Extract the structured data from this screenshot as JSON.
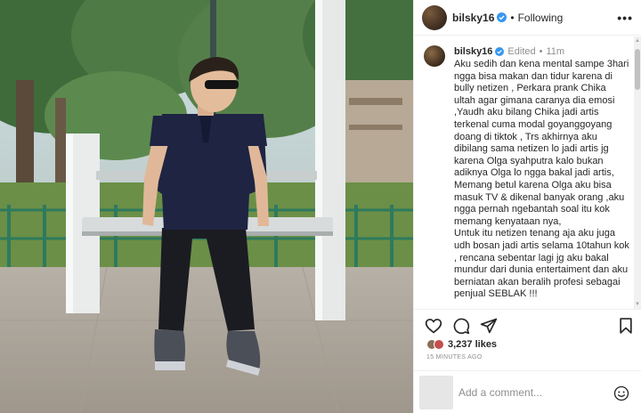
{
  "post": {
    "username": "bilsky16",
    "follow_status": "Following",
    "more_glyph": "•••"
  },
  "caption": {
    "username": "bilsky16",
    "edited": "Edited",
    "time": "11m",
    "paragraphs": [
      "Aku sedih dan kena mental sampe 3hari ngga bisa makan dan tidur karena di bully netizen , Perkara prank Chika ultah agar gimana caranya dia emosi ,Yaudh aku bilang Chika jadi artis terkenal cuma modal goyanggoyang doang di tiktok , Trs akhirnya aku dibilang sama netizen lo jadi artis jg karena Olga syahputra kalo bukan adiknya Olga lo ngga bakal jadi artis, Memang betul karena Olga aku bisa masuk TV & dikenal banyak orang ,aku ngga pernah ngebantah soal itu kok memang kenyataan nya,",
      "Untuk itu netizen tenang aja aku juga udh bosan jadi artis selama 10tahun kok , rencana sebentar lagi jg aku bakal mundur dari dunia entertaiment dan aku berniatan akan beralih profesi sebagai penjual SEBLAK !!!"
    ]
  },
  "stats": {
    "likes": "3,237 likes",
    "timestamp": "15 MINUTES AGO"
  },
  "comment_box": {
    "placeholder": "Add a comment..."
  },
  "icons": {
    "verified": "verified-badge-icon",
    "like": "heart-icon",
    "comment": "comment-bubble-icon",
    "share": "paper-plane-icon",
    "save": "bookmark-icon",
    "emoji": "smiley-icon",
    "more": "more-options-icon"
  },
  "colors": {
    "verified_blue": "#3897f0",
    "text": "#262626",
    "muted": "#8e8e8e",
    "border": "#efefef"
  }
}
